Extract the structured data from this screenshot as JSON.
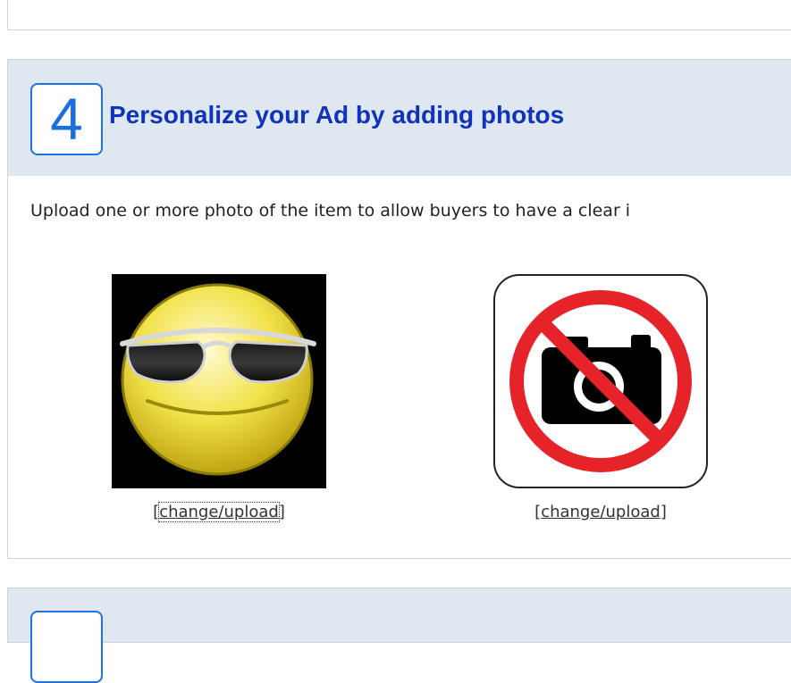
{
  "section": {
    "step_number": "4",
    "title": "Personalize your Ad by adding photos",
    "description": "Upload one or more photo of the item to allow buyers to have a clear i"
  },
  "photos": [
    {
      "image": "sunglasses-smiley-icon",
      "link_label": "change/upload"
    },
    {
      "image": "no-camera-icon",
      "link_label": "change/upload"
    }
  ],
  "colors": {
    "header_bg": "#dfe8f1",
    "step_accent": "#1a73e8",
    "title_color": "#1133bb",
    "no_photo_red": "#e52329"
  }
}
